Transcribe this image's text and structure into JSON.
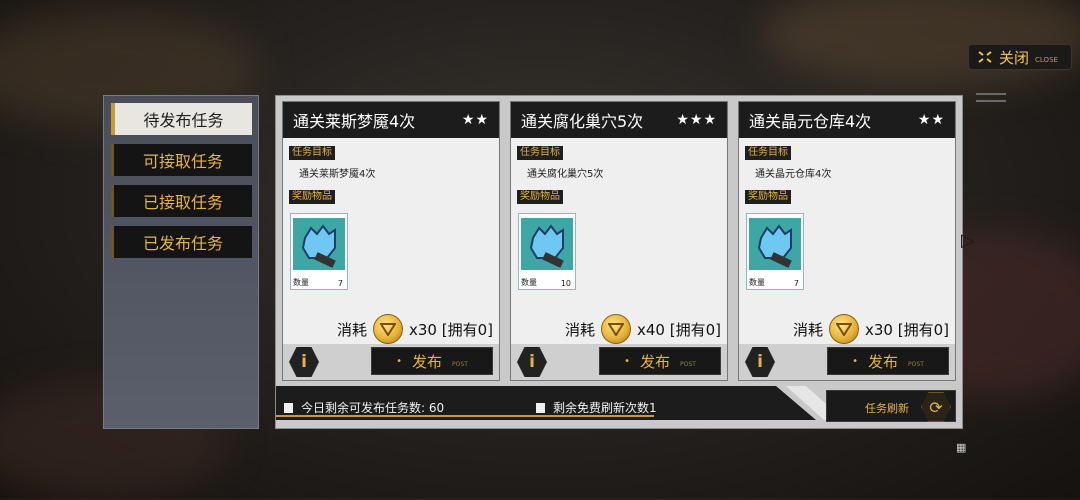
{
  "header": {
    "close_label": "关闭",
    "close_sub": "CLOSE"
  },
  "sidebar": {
    "items": [
      {
        "label": "待发布任务",
        "active": true
      },
      {
        "label": "可接取任务",
        "active": false
      },
      {
        "label": "已接取任务",
        "active": false
      },
      {
        "label": "已发布任务",
        "active": false
      }
    ]
  },
  "cards": [
    {
      "title": "通关莱斯梦魇4次",
      "stars": "★★",
      "goal_tag": "任务目标",
      "goal": "通关莱斯梦魇4次",
      "reward_tag": "奖励物品",
      "qty_label": "数量",
      "qty": "7",
      "cost_label": "消耗",
      "cost": "x30 [拥有0]",
      "publish": "发布",
      "publish_sub": "POST",
      "info": "i"
    },
    {
      "title": "通关腐化巢穴5次",
      "stars": "★★★",
      "goal_tag": "任务目标",
      "goal": "通关腐化巢穴5次",
      "reward_tag": "奖励物品",
      "qty_label": "数量",
      "qty": "10",
      "cost_label": "消耗",
      "cost": "x40 [拥有0]",
      "publish": "发布",
      "publish_sub": "POST",
      "info": "i"
    },
    {
      "title": "通关晶元仓库4次",
      "stars": "★★",
      "goal_tag": "任务目标",
      "goal": "通关晶元仓库4次",
      "reward_tag": "奖励物品",
      "qty_label": "数量",
      "qty": "7",
      "cost_label": "消耗",
      "cost": "x30 [拥有0]",
      "publish": "发布",
      "publish_sub": "POST",
      "info": "i"
    }
  ],
  "status": {
    "remaining_publish": "今日剩余可发布任务数: 60",
    "free_refresh": "剩余免费刷新次数1"
  },
  "refresh": {
    "label": "任务刷新"
  },
  "colors": {
    "gold": "#e6b24a",
    "panel_dark": "#1c1c1c",
    "item_bg": "#3fa6a6"
  }
}
